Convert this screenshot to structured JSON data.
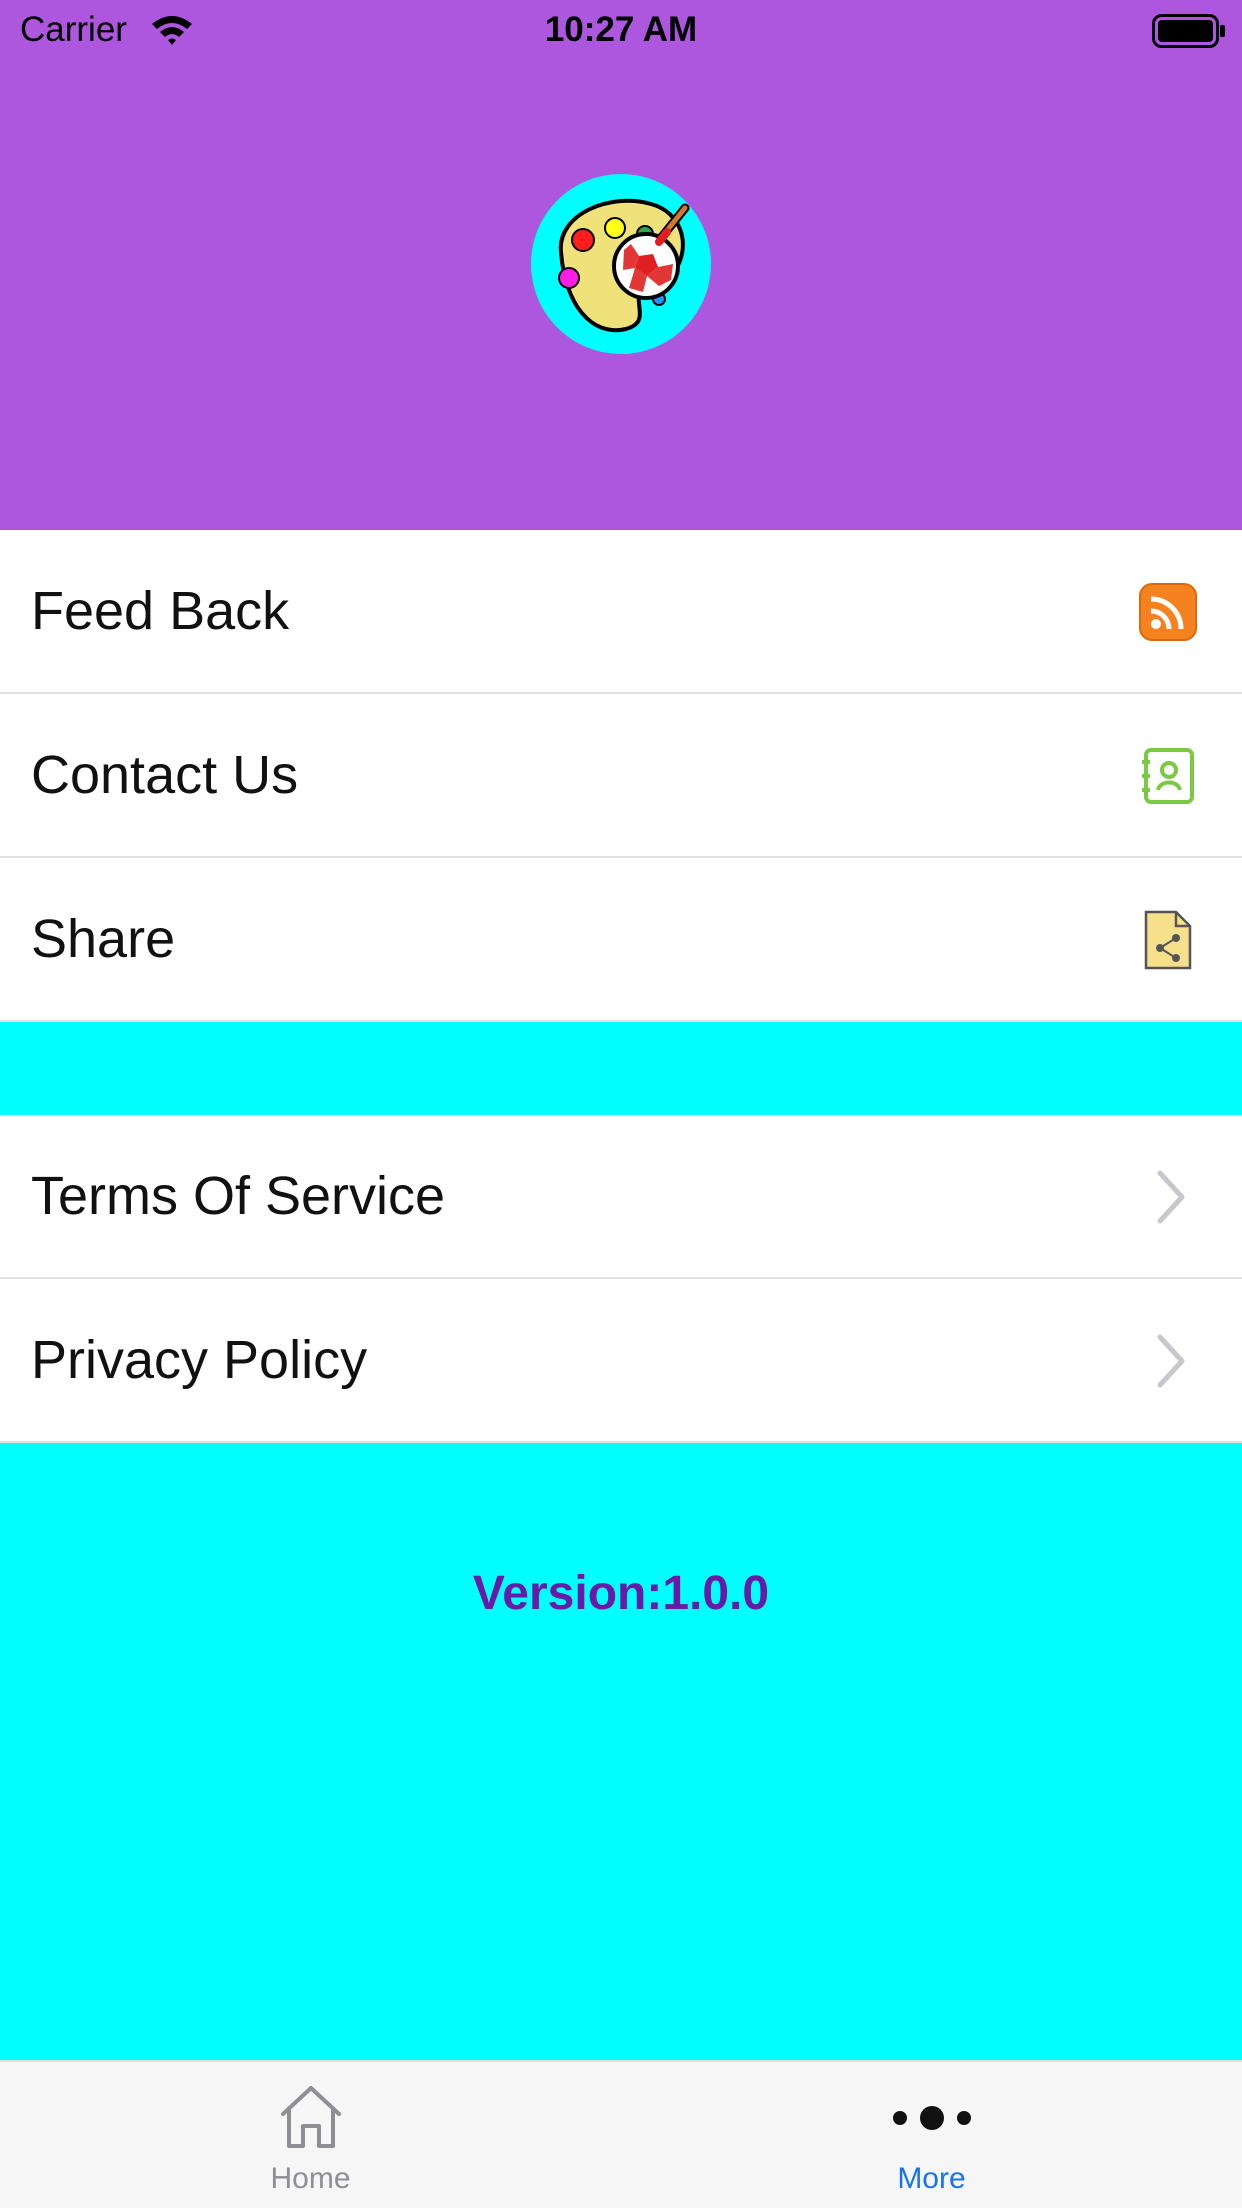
{
  "status_bar": {
    "carrier": "Carrier",
    "time": "10:27 AM"
  },
  "header": {
    "background": "#ad56de",
    "logo_icon": "paint-palette-soccer-ball-icon"
  },
  "menu_group_1": [
    {
      "label": "Feed Back",
      "icon": "rss-feed-icon",
      "icon_color": "#f5821f"
    },
    {
      "label": "Contact Us",
      "icon": "contact-book-icon",
      "icon_color": "#7ac943"
    },
    {
      "label": "Share",
      "icon": "share-document-icon",
      "icon_color": "#f7e08b"
    }
  ],
  "menu_group_2": [
    {
      "label": "Terms Of Service",
      "icon": "chevron-right-icon"
    },
    {
      "label": "Privacy Policy",
      "icon": "chevron-right-icon"
    }
  ],
  "footer": {
    "version": "Version:1.0.0",
    "version_color": "#6a1aa6",
    "background": "#00ffff"
  },
  "tab_bar": {
    "tabs": [
      {
        "label": "Home",
        "icon": "home-icon",
        "selected": false
      },
      {
        "label": "More",
        "icon": "more-dots-icon",
        "selected": true
      }
    ],
    "selected_color": "#1a73e8",
    "unselected_color": "#8e8e93"
  }
}
